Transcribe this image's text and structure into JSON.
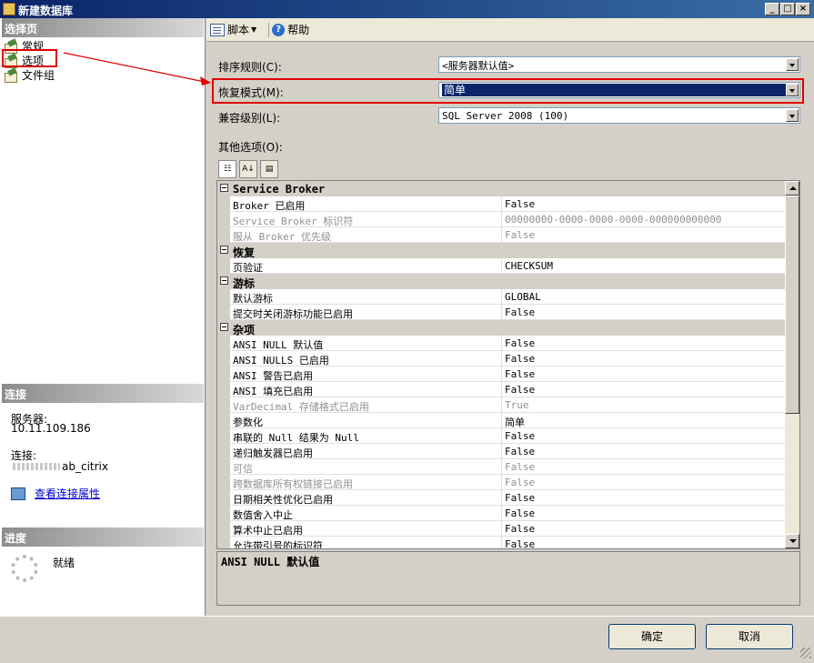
{
  "window": {
    "title": "新建数据库",
    "controls": [
      "_",
      "□",
      "×"
    ]
  },
  "left": {
    "select_page_header": "选择页",
    "pages": [
      {
        "label": "常规",
        "icon": "page-icon"
      },
      {
        "label": "选项",
        "icon": "page-icon"
      },
      {
        "label": "文件组",
        "icon": "page-icon"
      }
    ],
    "connection_header": "连接",
    "server_label": "服务器:",
    "server_value": "10.11.109.186",
    "connect_label": "连接:",
    "connect_value": "ab_citrix",
    "view_props_link": "查看连接属性",
    "progress_header": "进度",
    "progress_status": "就绪"
  },
  "toolbar": {
    "script_label": "脚本",
    "help_label": "帮助"
  },
  "options": {
    "collation_label": "排序规则(C):",
    "collation_value": "<服务器默认值>",
    "recovery_label": "恢复模式(M):",
    "recovery_value": "简单",
    "compat_label": "兼容级别(L):",
    "compat_value": "SQL Server 2008 (100)",
    "other_label": "其他选项(O):"
  },
  "grid": {
    "rows": [
      {
        "type": "cat",
        "name": "Service Broker"
      },
      {
        "name": "Broker 已启用",
        "value": "False"
      },
      {
        "name": "Service Broker 标识符",
        "value": "00000000-0000-0000-0000-000000000000",
        "disabled": true
      },
      {
        "name": "服从 Broker 优先级",
        "value": "False",
        "disabled": true
      },
      {
        "type": "cat",
        "name": "恢复"
      },
      {
        "name": "页验证",
        "value": "CHECKSUM"
      },
      {
        "type": "cat",
        "name": "游标"
      },
      {
        "name": "默认游标",
        "value": "GLOBAL"
      },
      {
        "name": "提交时关闭游标功能已启用",
        "value": "False"
      },
      {
        "type": "cat",
        "name": "杂项"
      },
      {
        "name": "ANSI NULL 默认值",
        "value": "False"
      },
      {
        "name": "ANSI NULLS 已启用",
        "value": "False"
      },
      {
        "name": "ANSI 警告已启用",
        "value": "False"
      },
      {
        "name": "ANSI 填充已启用",
        "value": "False"
      },
      {
        "name": "VarDecimal 存储格式已启用",
        "value": "True",
        "disabled": true
      },
      {
        "name": "参数化",
        "value": "简单"
      },
      {
        "name": "串联的 Null 结果为 Null",
        "value": "False"
      },
      {
        "name": "递归触发器已启用",
        "value": "False"
      },
      {
        "name": "可信",
        "value": "False",
        "disabled": true
      },
      {
        "name": "跨数据库所有权链接已启用",
        "value": "False",
        "disabled": true
      },
      {
        "name": "日期相关性优化已启用",
        "value": "False"
      },
      {
        "name": "数值舍入中止",
        "value": "False"
      },
      {
        "name": "算术中止已启用",
        "value": "False"
      },
      {
        "name": "允许带引号的标识符",
        "value": "False"
      }
    ],
    "description_title": "ANSI NULL 默认值"
  },
  "buttons": {
    "ok": "确定",
    "cancel": "取消"
  },
  "colors": {
    "highlight_box": "#e00000",
    "selection": "#0a246a"
  }
}
